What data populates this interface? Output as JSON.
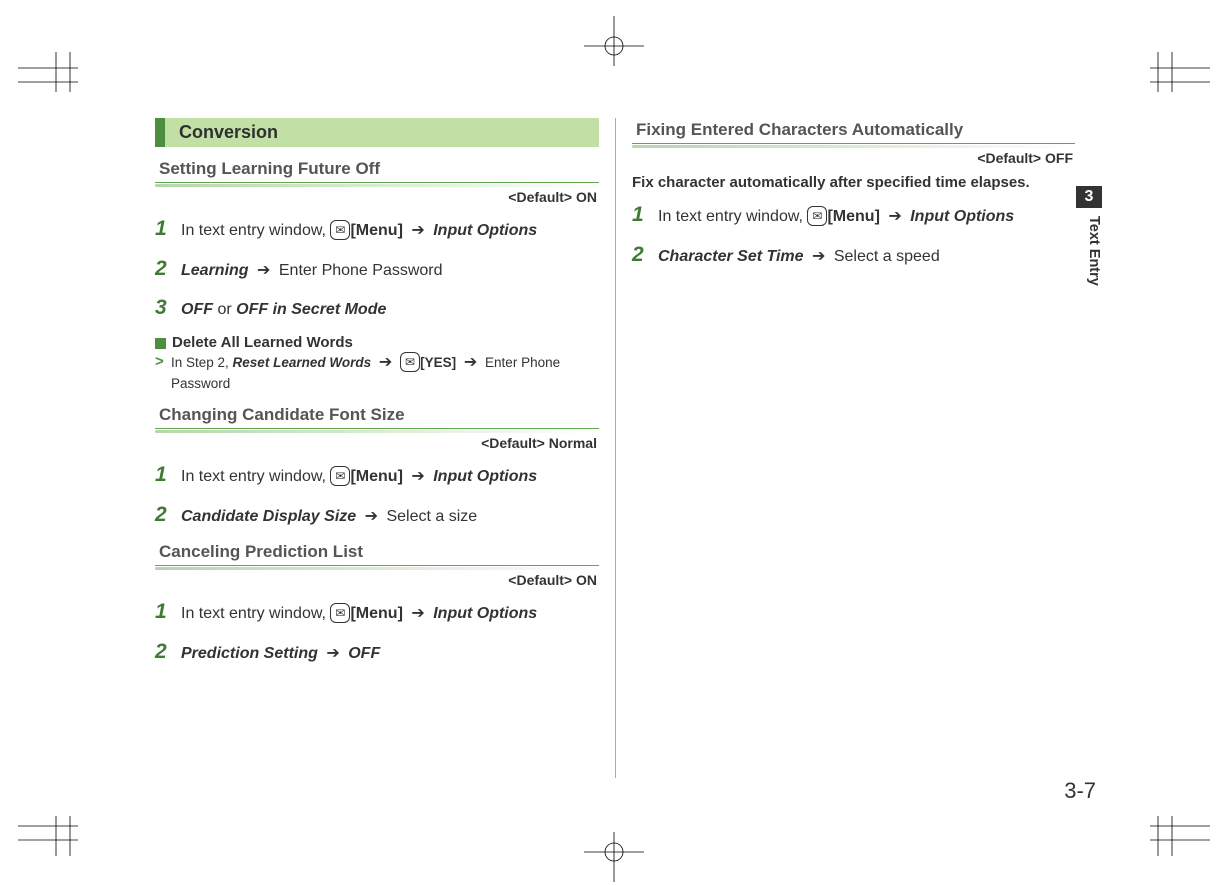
{
  "section": {
    "title": "Conversion"
  },
  "sub1": {
    "title": "Setting Learning Future Off",
    "default": "<Default> ON",
    "steps": [
      {
        "n": "1",
        "pre": "In text entry window, ",
        "btn": "[Menu]",
        "tail_bi": "Input Options"
      },
      {
        "n": "2",
        "lead_bi": "Learning",
        "tail": "Enter Phone Password"
      },
      {
        "n": "3",
        "lead_bi": "OFF",
        "mid": " or ",
        "tail_bi": "OFF in Secret Mode"
      }
    ],
    "note_title": "Delete All Learned Words",
    "note_body_pre": "In Step 2, ",
    "note_body_bi": "Reset Learned Words",
    "note_body_btn": "[YES]",
    "note_body_tail": "Enter Phone Password"
  },
  "sub2": {
    "title": "Changing Candidate Font Size",
    "default": "<Default> Normal",
    "steps": [
      {
        "n": "1",
        "pre": "In text entry window, ",
        "btn": "[Menu]",
        "tail_bi": "Input Options"
      },
      {
        "n": "2",
        "lead_bi": "Candidate Display Size",
        "tail": "Select a size"
      }
    ]
  },
  "sub3": {
    "title": "Canceling Prediction List",
    "default": "<Default> ON",
    "steps": [
      {
        "n": "1",
        "pre": "In text entry window, ",
        "btn": "[Menu]",
        "tail_bi": "Input Options"
      },
      {
        "n": "2",
        "lead_bi": "Prediction Setting",
        "tail_bi": "OFF"
      }
    ]
  },
  "right1": {
    "title": "Fixing Entered Characters Automatically",
    "default": "<Default> OFF",
    "intro": "Fix character automatically after specified time elapses.",
    "steps": [
      {
        "n": "1",
        "pre": "In text entry window, ",
        "btn": "[Menu]",
        "tail_bi": "Input Options"
      },
      {
        "n": "2",
        "lead_bi": "Character Set Time",
        "tail": "Select a speed"
      }
    ]
  },
  "side": {
    "chapter_num": "3",
    "chapter_label": "Text Entry"
  },
  "page_number": "3-7"
}
